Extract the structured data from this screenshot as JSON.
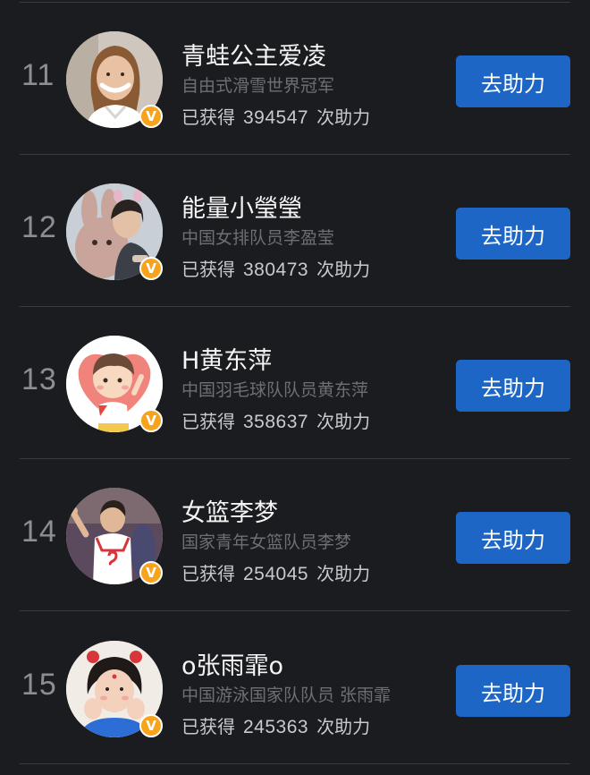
{
  "entries": [
    {
      "rank": "11",
      "name": "青蛙公主爱凌",
      "description": "自由式滑雪世界冠军",
      "count_prefix": "已获得",
      "count": "394547",
      "count_suffix": "次助力",
      "button_label": "去助力",
      "verified_badge": "V"
    },
    {
      "rank": "12",
      "name": "能量小瑩瑩",
      "description": "中国女排队员李盈莹",
      "count_prefix": "已获得",
      "count": "380473",
      "count_suffix": "次助力",
      "button_label": "去助力",
      "verified_badge": "V"
    },
    {
      "rank": "13",
      "name": "H黄东萍",
      "description": "中国羽毛球队队员黄东萍",
      "count_prefix": "已获得",
      "count": "358637",
      "count_suffix": "次助力",
      "button_label": "去助力",
      "verified_badge": "V"
    },
    {
      "rank": "14",
      "name": "女篮李梦",
      "description": "国家青年女篮队员李梦",
      "count_prefix": "已获得",
      "count": "254045",
      "count_suffix": "次助力",
      "button_label": "去助力",
      "verified_badge": "V"
    },
    {
      "rank": "15",
      "name": "o张雨霏o",
      "description": "中国游泳国家队队员 张雨霏",
      "count_prefix": "已获得",
      "count": "245363",
      "count_suffix": "次助力",
      "button_label": "去助力",
      "verified_badge": "V"
    }
  ],
  "colors": {
    "background": "#1b1c1f",
    "button": "#1d66c5",
    "divider": "#3a3b3f",
    "badge": "#f7a31c",
    "rank": "#8d8e92",
    "description": "#6e6f73"
  }
}
